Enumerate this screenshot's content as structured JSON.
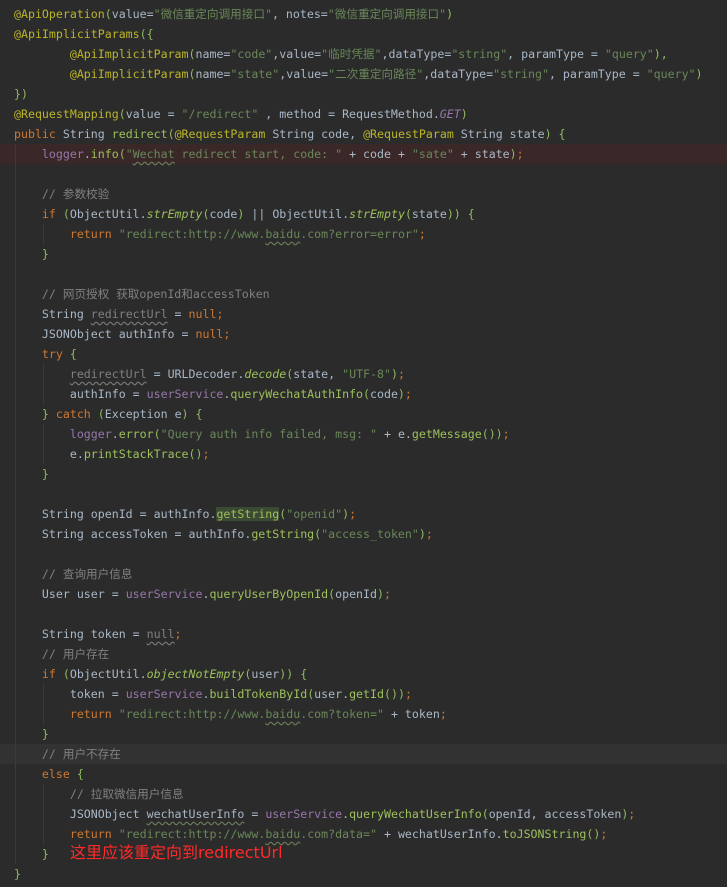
{
  "colors": {
    "background": "#2B2B2B",
    "annotation": "#BBB529",
    "string": "#6A8759",
    "keyword": "#CC7832",
    "text": "#A9B7C6",
    "method": "#9CC05A",
    "field": "#9876AA",
    "comment": "#808080",
    "error_line": "#3A2828",
    "current_line": "#323232",
    "note": "#FF2A2A"
  },
  "lines": [
    {
      "lead": "",
      "tokens": [
        [
          "@ApiOperation",
          "a"
        ],
        [
          "(",
          "p"
        ],
        [
          "value=",
          "t"
        ],
        [
          "\"微信重定向调用接口\"",
          "s"
        ],
        [
          ", ",
          "t"
        ],
        [
          "notes=",
          "t"
        ],
        [
          "\"微信重定向调用接口\"",
          "s"
        ],
        [
          ")",
          "p"
        ]
      ]
    },
    {
      "lead": "",
      "tokens": [
        [
          "@ApiImplicitParams",
          "a"
        ],
        [
          "({",
          "p"
        ]
      ]
    },
    {
      "lead": "        ",
      "tokens": [
        [
          "@ApiImplicitParam",
          "a"
        ],
        [
          "(",
          "p"
        ],
        [
          "name=",
          "t"
        ],
        [
          "\"code\"",
          "s"
        ],
        [
          ",value=",
          "t"
        ],
        [
          "\"临时凭据\"",
          "s"
        ],
        [
          ",dataType=",
          "t"
        ],
        [
          "\"string\"",
          "s"
        ],
        [
          ", paramType = ",
          "t"
        ],
        [
          "\"query\"",
          "s"
        ],
        [
          "),",
          "p"
        ]
      ]
    },
    {
      "lead": "        ",
      "tokens": [
        [
          "@ApiImplicitParam",
          "a"
        ],
        [
          "(",
          "p"
        ],
        [
          "name=",
          "t"
        ],
        [
          "\"state\"",
          "s"
        ],
        [
          ",value=",
          "t"
        ],
        [
          "\"二次重定向路径\"",
          "s"
        ],
        [
          ",dataType=",
          "t"
        ],
        [
          "\"string\"",
          "s"
        ],
        [
          ", paramType = ",
          "t"
        ],
        [
          "\"query\"",
          "s"
        ],
        [
          ")",
          "p"
        ]
      ]
    },
    {
      "lead": "",
      "tokens": [
        [
          "})",
          "p"
        ]
      ]
    },
    {
      "lead": "",
      "tokens": [
        [
          "@RequestMapping",
          "a"
        ],
        [
          "(",
          "p"
        ],
        [
          "value = ",
          "t"
        ],
        [
          "\"/redirect\"",
          "s"
        ],
        [
          " , method = RequestMethod.",
          "t"
        ],
        [
          "GET",
          "ic"
        ],
        [
          ")",
          "p"
        ]
      ]
    },
    {
      "lead": "",
      "tokens": [
        [
          "public ",
          "k"
        ],
        [
          "String ",
          "t"
        ],
        [
          "redirect",
          "m"
        ],
        [
          "(",
          "p"
        ],
        [
          "@RequestParam ",
          "a"
        ],
        [
          "String code, ",
          "t"
        ],
        [
          "@RequestParam ",
          "a"
        ],
        [
          "String state",
          "t"
        ],
        [
          ") {",
          "p"
        ]
      ]
    },
    {
      "lead": "    ",
      "state": "err",
      "tokens": [
        [
          "logger",
          "f"
        ],
        [
          ".",
          "t"
        ],
        [
          "info",
          "m"
        ],
        [
          "(",
          "p"
        ],
        [
          "\"",
          "s"
        ],
        [
          "Wechat",
          "s w"
        ],
        [
          " redirect start, code: \"",
          "s"
        ],
        [
          " + code + ",
          "t"
        ],
        [
          "\"sate\"",
          "s"
        ],
        [
          " + state",
          "t"
        ],
        [
          ")",
          "p"
        ],
        [
          ";",
          "k"
        ]
      ]
    },
    {
      "lead": "",
      "tokens": []
    },
    {
      "lead": "    ",
      "tokens": [
        [
          "// 参数校验",
          "c"
        ]
      ]
    },
    {
      "lead": "    ",
      "tokens": [
        [
          "if ",
          "k"
        ],
        [
          "(",
          "p"
        ],
        [
          "ObjectUtil.",
          "t"
        ],
        [
          "strEmpty",
          "i"
        ],
        [
          "(",
          "p"
        ],
        [
          "code",
          "t"
        ],
        [
          ") ",
          "p"
        ],
        [
          "|| ",
          "t"
        ],
        [
          "ObjectUtil.",
          "t"
        ],
        [
          "strEmpty",
          "i"
        ],
        [
          "(",
          "p"
        ],
        [
          "state",
          "t"
        ],
        [
          ")) {",
          "p"
        ]
      ]
    },
    {
      "lead": "        ",
      "tokens": [
        [
          "return ",
          "k"
        ],
        [
          "\"redirect:http://www.",
          "s"
        ],
        [
          "baidu",
          "s w"
        ],
        [
          ".com?error=error\"",
          "s"
        ],
        [
          ";",
          "k"
        ]
      ]
    },
    {
      "lead": "    ",
      "tokens": [
        [
          "}",
          "p"
        ]
      ]
    },
    {
      "lead": "",
      "tokens": []
    },
    {
      "lead": "    ",
      "tokens": [
        [
          "// 网页授权 获取openId和accessToken",
          "c"
        ]
      ]
    },
    {
      "lead": "    ",
      "tokens": [
        [
          "String ",
          "t"
        ],
        [
          "redirectUrl",
          "u"
        ],
        [
          " = ",
          "t"
        ],
        [
          "null",
          "k"
        ],
        [
          ";",
          "k"
        ]
      ]
    },
    {
      "lead": "    ",
      "tokens": [
        [
          "JSONObject authInfo = ",
          "t"
        ],
        [
          "null",
          "k"
        ],
        [
          ";",
          "k"
        ]
      ]
    },
    {
      "lead": "    ",
      "tokens": [
        [
          "try ",
          "k"
        ],
        [
          "{",
          "p"
        ]
      ]
    },
    {
      "lead": "        ",
      "tokens": [
        [
          "redirectUrl",
          "u"
        ],
        [
          " = URLDecoder.",
          "t"
        ],
        [
          "decode",
          "i"
        ],
        [
          "(",
          "p"
        ],
        [
          "state, ",
          "t"
        ],
        [
          "\"UTF-8\"",
          "s"
        ],
        [
          ")",
          "p"
        ],
        [
          ";",
          "k"
        ]
      ]
    },
    {
      "lead": "        ",
      "tokens": [
        [
          "authInfo = ",
          "t"
        ],
        [
          "userService",
          "f"
        ],
        [
          ".",
          "t"
        ],
        [
          "queryWechatAuthInfo",
          "m"
        ],
        [
          "(",
          "p"
        ],
        [
          "code",
          "t"
        ],
        [
          ")",
          "p"
        ],
        [
          ";",
          "k"
        ]
      ]
    },
    {
      "lead": "    ",
      "tokens": [
        [
          "} ",
          "p"
        ],
        [
          "catch ",
          "k"
        ],
        [
          "(",
          "p"
        ],
        [
          "Exception e",
          "t"
        ],
        [
          ") {",
          "p"
        ]
      ]
    },
    {
      "lead": "        ",
      "tokens": [
        [
          "logger",
          "f"
        ],
        [
          ".",
          "t"
        ],
        [
          "error",
          "m"
        ],
        [
          "(",
          "p"
        ],
        [
          "\"Query auth info failed, msg: \"",
          "s"
        ],
        [
          " + e.",
          "t"
        ],
        [
          "getMessage",
          "m"
        ],
        [
          "())",
          "p"
        ],
        [
          ";",
          "k"
        ]
      ]
    },
    {
      "lead": "        ",
      "tokens": [
        [
          "e.",
          "t"
        ],
        [
          "printStackTrace",
          "m"
        ],
        [
          "()",
          "p"
        ],
        [
          ";",
          "k"
        ]
      ]
    },
    {
      "lead": "    ",
      "tokens": [
        [
          "}",
          "p"
        ]
      ]
    },
    {
      "lead": "",
      "tokens": []
    },
    {
      "lead": "    ",
      "tokens": [
        [
          "String openId = authInfo.",
          "t"
        ],
        [
          "getString",
          "m h"
        ],
        [
          "(",
          "p"
        ],
        [
          "\"openid\"",
          "s"
        ],
        [
          ")",
          "p"
        ],
        [
          ";",
          "k"
        ]
      ]
    },
    {
      "lead": "    ",
      "tokens": [
        [
          "String accessToken = authInfo.",
          "t"
        ],
        [
          "getString",
          "m"
        ],
        [
          "(",
          "p"
        ],
        [
          "\"access_token\"",
          "s"
        ],
        [
          ")",
          "p"
        ],
        [
          ";",
          "k"
        ]
      ]
    },
    {
      "lead": "",
      "tokens": []
    },
    {
      "lead": "    ",
      "tokens": [
        [
          "// 查询用户信息",
          "c"
        ]
      ]
    },
    {
      "lead": "    ",
      "tokens": [
        [
          "User user = ",
          "t"
        ],
        [
          "userService",
          "f"
        ],
        [
          ".",
          "t"
        ],
        [
          "queryUserByOpenId",
          "m"
        ],
        [
          "(",
          "p"
        ],
        [
          "openId",
          "t"
        ],
        [
          ")",
          "p"
        ],
        [
          ";",
          "k"
        ]
      ]
    },
    {
      "lead": "",
      "tokens": []
    },
    {
      "lead": "    ",
      "tokens": [
        [
          "String token = ",
          "t"
        ],
        [
          "null",
          "u"
        ],
        [
          ";",
          "k"
        ]
      ]
    },
    {
      "lead": "    ",
      "tokens": [
        [
          "// 用户存在",
          "c"
        ]
      ]
    },
    {
      "lead": "    ",
      "tokens": [
        [
          "if ",
          "k"
        ],
        [
          "(",
          "p"
        ],
        [
          "ObjectUtil.",
          "t"
        ],
        [
          "objectNotEmpty",
          "i"
        ],
        [
          "(",
          "p"
        ],
        [
          "user",
          "t"
        ],
        [
          ")) {",
          "p"
        ]
      ]
    },
    {
      "lead": "        ",
      "tokens": [
        [
          "token = ",
          "t"
        ],
        [
          "userService",
          "f"
        ],
        [
          ".",
          "t"
        ],
        [
          "buildTokenById",
          "m"
        ],
        [
          "(",
          "p"
        ],
        [
          "user.",
          "t"
        ],
        [
          "getId",
          "m"
        ],
        [
          "())",
          "p"
        ],
        [
          ";",
          "k"
        ]
      ]
    },
    {
      "lead": "        ",
      "tokens": [
        [
          "return ",
          "k"
        ],
        [
          "\"redirect:http://www.",
          "s"
        ],
        [
          "baidu",
          "s w"
        ],
        [
          ".com?token=\"",
          "s"
        ],
        [
          " + token",
          "t"
        ],
        [
          ";",
          "k"
        ]
      ]
    },
    {
      "lead": "    ",
      "tokens": [
        [
          "}",
          "p"
        ]
      ]
    },
    {
      "lead": "    ",
      "state": "cur",
      "tokens": [
        [
          "// 用户不存在",
          "c"
        ]
      ]
    },
    {
      "lead": "    ",
      "tokens": [
        [
          "else ",
          "k"
        ],
        [
          "{",
          "p"
        ]
      ]
    },
    {
      "lead": "        ",
      "tokens": [
        [
          "// 拉取微信用户信息",
          "c"
        ]
      ]
    },
    {
      "lead": "        ",
      "tokens": [
        [
          "JSONObject ",
          "t"
        ],
        [
          "wechatUserInfo",
          "t w"
        ],
        [
          " = ",
          "t"
        ],
        [
          "userService",
          "f"
        ],
        [
          ".",
          "t"
        ],
        [
          "queryWechatUserInfo",
          "m"
        ],
        [
          "(",
          "p"
        ],
        [
          "openId, accessToken",
          "t"
        ],
        [
          ")",
          "p"
        ],
        [
          ";",
          "k"
        ]
      ]
    },
    {
      "lead": "        ",
      "tokens": [
        [
          "return ",
          "k"
        ],
        [
          "\"redirect:http://www.",
          "s"
        ],
        [
          "baidu",
          "s w"
        ],
        [
          ".com?data=\"",
          "s"
        ],
        [
          " + wechatUserInfo.",
          "t"
        ],
        [
          "toJSONString",
          "m"
        ],
        [
          "()",
          "p"
        ],
        [
          ";",
          "k"
        ]
      ]
    },
    {
      "lead": "    ",
      "tokens": [
        [
          "}",
          "p"
        ]
      ]
    },
    {
      "lead": "",
      "tokens": [
        [
          "}",
          "p"
        ]
      ]
    }
  ],
  "note": "这里应该重定向到redirectUrl"
}
